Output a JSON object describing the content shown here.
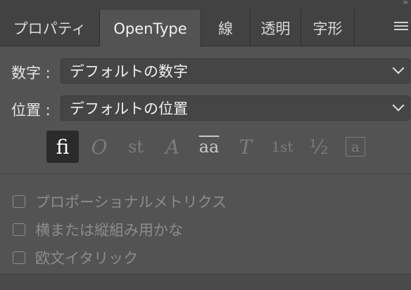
{
  "tabs": [
    {
      "label": "プロパティ",
      "active": false
    },
    {
      "label": "OpenType",
      "active": true
    },
    {
      "label": "線",
      "active": false
    },
    {
      "label": "透明",
      "active": false
    },
    {
      "label": "字形",
      "active": false
    }
  ],
  "figure": {
    "label": "数字 :",
    "value": "デフォルトの数字"
  },
  "position": {
    "label": "位置 :",
    "value": "デフォルトの位置"
  },
  "features": [
    {
      "glyph": "ﬁ",
      "icon": "standard-ligature-icon",
      "selected": true
    },
    {
      "glyph": "O",
      "icon": "contextual-alternates-icon",
      "selected": false
    },
    {
      "glyph": "st",
      "icon": "discretionary-ligature-icon",
      "selected": false
    },
    {
      "glyph": "A",
      "icon": "swash-icon",
      "selected": false
    },
    {
      "glyph": "aa",
      "icon": "stylistic-alternates-icon",
      "selected": false
    },
    {
      "glyph": "T",
      "icon": "titling-alternates-icon",
      "selected": false
    },
    {
      "glyph": "1st",
      "icon": "ordinals-icon",
      "selected": false
    },
    {
      "glyph": "½",
      "icon": "fractions-icon",
      "selected": false
    },
    {
      "glyph": "a",
      "icon": "stylistic-sets-icon",
      "selected": false
    }
  ],
  "checkboxes": [
    {
      "label": "プロポーショナルメトリクス",
      "checked": false
    },
    {
      "label": "横または縦組み用かな",
      "checked": false
    },
    {
      "label": "欧文イタリック",
      "checked": false
    }
  ]
}
